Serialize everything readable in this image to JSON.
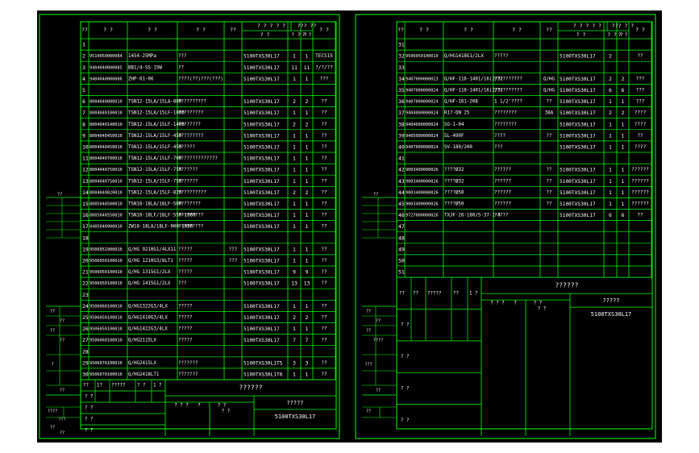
{
  "colors": {
    "background": "#000000",
    "line": "#00ff00",
    "text": "#ffffff",
    "page": "#ffffff"
  },
  "left_sheet": {
    "header": [
      "??",
      "? ?",
      "? ?",
      "? ?",
      "??",
      "? ? ? ? ?",
      "? ?",
      "??? ??",
      "? ?"
    ],
    "header_sub": [
      "? ?",
      "? ? ?",
      "? ?"
    ],
    "rows": [
      {
        "n": "1",
        "code": "",
        "name": "",
        "spec": "",
        "note": "",
        "part": "",
        "q1": "",
        "q2": "",
        "last": ""
      },
      {
        "n": "2",
        "code": "9510050000084",
        "name": "1454-25MPa",
        "spec": "???",
        "note": "",
        "part": "5100TXS30L17",
        "q1": "1",
        "q2": "1",
        "last": "TECS15"
      },
      {
        "n": "3",
        "code": "9404040000085",
        "name": "BB1/4-SS-15W",
        "spec": "??",
        "note": "",
        "part": "5100TXS30L17",
        "q1": "11",
        "q2": "11",
        "last": "?/?/??"
      },
      {
        "n": "4",
        "code": "9404040000086",
        "name": "ZHP-01-06",
        "spec": "????(??)???(???)",
        "note": "",
        "part": "5100TXS30L17",
        "q1": "1",
        "q2": "1",
        "last": "???"
      },
      {
        "n": "5",
        "code": "",
        "name": "",
        "spec": "",
        "note": "",
        "part": "",
        "q1": "",
        "q2": "",
        "last": ""
      },
      {
        "n": "6",
        "code": "8004040080010",
        "name": "TSN12-15LA/15LA-800",
        "spec": "??????????",
        "note": "",
        "part": "5100TXS30L17",
        "q1": "2",
        "q2": "2",
        "last": "??"
      },
      {
        "n": "7",
        "code": "8004040100010",
        "name": "TSN12-15LA/15LF-1000",
        "spec": "?????????",
        "note": "",
        "part": "5100TXS30L17",
        "q1": "1",
        "q2": "1",
        "last": "??"
      },
      {
        "n": "8",
        "code": "8004040140010",
        "name": "TSN12-15LA/15LF-1400",
        "spec": "????????",
        "note": "",
        "part": "5100TXS30L17",
        "q1": "2",
        "q2": "2",
        "last": "??"
      },
      {
        "n": "9",
        "code": "8004040450010",
        "name": "TSN12-15LA/15LF-450",
        "spec": "?????????",
        "note": "",
        "part": "5100TXS30L17",
        "q1": "1",
        "q2": "1",
        "last": "??"
      },
      {
        "n": "10",
        "code": "8004040450010",
        "name": "TSN12-15LA/15LF-450",
        "spec": "??????",
        "note": "",
        "part": "5100TXS30L17",
        "q1": "1",
        "q2": "1",
        "last": "??"
      },
      {
        "n": "11",
        "code": "8004040700010",
        "name": "TSN12-15LA/15LF-700",
        "spec": "??????????????",
        "note": "",
        "part": "5100TXS30L17",
        "q1": "1",
        "q2": "1",
        "last": "??"
      },
      {
        "n": "12",
        "code": "8004040750010",
        "name": "TSN12-15LA/15LF-750",
        "spec": "???????",
        "note": "",
        "part": "5100TXS30L17",
        "q1": "1",
        "q2": "1",
        "last": "??"
      },
      {
        "n": "13",
        "code": "8004040750010",
        "name": "TSN12-15LA/15LF-750",
        "spec": "???????",
        "note": "",
        "part": "5100TXS30L17",
        "q1": "1",
        "q2": "1",
        "last": "??"
      },
      {
        "n": "14",
        "code": "8004040820010",
        "name": "TSN12-15LA/15LF-820",
        "spec": "??????????",
        "note": "",
        "part": "5100TXS30L17",
        "q1": "2",
        "q2": "2",
        "last": "??"
      },
      {
        "n": "15",
        "code": "8005040500010",
        "name": "TSN16-18LA/18LF-500",
        "spec": "????????",
        "note": "",
        "part": "5100TXS30L17",
        "q1": "1",
        "q2": "1",
        "last": "??"
      },
      {
        "n": "16",
        "code": "8005040550010",
        "name": "TSN16-18LF/18LF-550-1000",
        "spec": "?????????",
        "note": "",
        "part": "5100TXS30L17",
        "q1": "1",
        "q2": "1",
        "last": "??"
      },
      {
        "n": "17",
        "code": "8405040900010",
        "name": "ZW18-18LA/18LF-900-1000",
        "spec": "?????????",
        "note": "",
        "part": "5100TXS30L17",
        "q1": "1",
        "q2": "1",
        "last": "??"
      },
      {
        "n": "18",
        "code": "",
        "name": "",
        "spec": "",
        "note": "",
        "part": "",
        "q1": "",
        "q2": "",
        "last": ""
      },
      {
        "n": "19",
        "code": "9506052900010",
        "name": "Q/HG 9210G1/4LX11",
        "spec": "?????",
        "note": "???",
        "part": "5100TXS30L17",
        "q1": "1",
        "q2": "1",
        "last": "??"
      },
      {
        "n": "20",
        "code": "9506050100010",
        "name": "Q/HG 1210G3/8LT1",
        "spec": "?????",
        "note": "???",
        "part": "5100TXS30L17",
        "q1": "1",
        "q2": "1",
        "last": "??"
      },
      {
        "n": "21",
        "code": "9506050100010",
        "name": "Q/HG 1315G1/2LX",
        "spec": "?????",
        "note": "",
        "part": "5100TXS30L17",
        "q1": "9",
        "q2": "9",
        "last": "??"
      },
      {
        "n": "22",
        "code": "9506050100010",
        "name": "Q/HG 1415G1/2LX",
        "spec": "???",
        "note": "",
        "part": "5100TXS30L17",
        "q1": "13",
        "q2": "13",
        "last": "??"
      },
      {
        "n": "23",
        "code": "",
        "name": "",
        "spec": "",
        "note": "",
        "part": "",
        "q1": "",
        "q2": "",
        "last": ""
      },
      {
        "n": "24",
        "code": "9506060100010",
        "name": "Q/HG1322G3/4LX",
        "spec": "?????",
        "note": "",
        "part": "5100TXS30L17",
        "q1": "1",
        "q2": "1",
        "last": "??"
      },
      {
        "n": "25",
        "code": "9506050100010",
        "name": "Q/HG1410G3/4LX",
        "spec": "?????",
        "note": "",
        "part": "5100TXS30L17",
        "q1": "2",
        "q2": "2",
        "last": "??"
      },
      {
        "n": "26",
        "code": "9506050100010",
        "name": "Q/HG1422G3/4LX",
        "spec": "?????",
        "note": "",
        "part": "5100TXS30L17",
        "q1": "1",
        "q2": "1",
        "last": "??"
      },
      {
        "n": "27",
        "code": "9506060100010",
        "name": "Q/HG2115LX",
        "spec": "?????",
        "note": "",
        "part": "5100TXS30L17",
        "q1": "7",
        "q2": "7",
        "last": "??"
      },
      {
        "n": "28",
        "code": "",
        "name": "",
        "spec": "",
        "note": "",
        "part": "",
        "q1": "",
        "q2": "",
        "last": ""
      },
      {
        "n": "29",
        "code": "9506070100010",
        "name": "Q/HG2415LX",
        "spec": "???????",
        "note": "",
        "part": "5100TXS30L1T5",
        "q1": "3",
        "q2": "3",
        "last": "??"
      },
      {
        "n": "30",
        "code": "9506070100010",
        "name": "Q/HG2418LT1",
        "spec": "???????",
        "note": "",
        "part": "5100TXS30L1T6",
        "q1": "1",
        "q2": "1",
        "last": "??"
      }
    ],
    "title_block": {
      "sign_row1": [
        "??",
        "1?",
        "?????",
        "? ?",
        "1 ?"
      ],
      "sign_row2": [
        "? ?"
      ],
      "sign_row3": [
        "? ?"
      ],
      "sign_row4": [
        "? ?"
      ],
      "sign_row5": [
        "? ?"
      ],
      "big_title": "??????",
      "sub_title": "?????",
      "mid_a": "? ? ?",
      "mid_b": "?",
      "mid_c": "? ?",
      "mid_d": "? ?",
      "drawing_no": "5100TXS30L17"
    },
    "side_labels": [
      "??",
      "??",
      "??",
      "??",
      "??",
      "?",
      "??",
      "????",
      "???",
      "??",
      "??"
    ]
  },
  "right_sheet": {
    "header": [
      "??",
      "? ?",
      "? ?",
      "? ?",
      "??",
      "? ? ? ? ?",
      "? ?",
      "??? ? ?",
      "? ?"
    ],
    "header_sub": [
      "? ?",
      "? ? ?",
      "? ?"
    ],
    "rows": [
      {
        "n": "31",
        "code": "",
        "name": "",
        "spec": "",
        "note": "",
        "part": "",
        "q1": "",
        "q2": "",
        "last": ""
      },
      {
        "n": "32",
        "code": "9506050100010",
        "name": "Q/HG1418G1/2LX",
        "spec": "?????",
        "note": "",
        "part": "5100TXS30L17",
        "q1": "2",
        "q2": "",
        "last": "??"
      },
      {
        "n": "33",
        "code": "",
        "name": "",
        "spec": "",
        "note": "",
        "part": "",
        "q1": "",
        "q2": "",
        "last": ""
      },
      {
        "n": "34",
        "code": "9407000000023",
        "name": "Q/HF-116-1401/16(2/3)",
        "spec": "??????????",
        "note": "Q/HG",
        "part": "5100TXS30L17",
        "q1": "2",
        "q2": "2",
        "last": "???"
      },
      {
        "n": "35",
        "code": "9407000000024",
        "name": "Q/HF-116-1401/16(2/3)",
        "spec": "??????????",
        "note": "Q/HG",
        "part": "5100TXS30L17",
        "q1": "6",
        "q2": "6",
        "last": "???"
      },
      {
        "n": "36",
        "code": "9407000000024",
        "name": "Q/HF-161-208",
        "spec": "1 1/2'????",
        "note": "??",
        "part": "5100TXS30L17",
        "q1": "1",
        "q2": "1",
        "last": "???"
      },
      {
        "n": "37",
        "code": "9404000000024",
        "name": "R17-DN 25",
        "spec": "????????",
        "note": "38A",
        "part": "5100TXS30L17",
        "q1": "2",
        "q2": "2",
        "last": "????"
      },
      {
        "n": "38",
        "code": "9404000000024",
        "name": "SG-1-04",
        "spec": "????????",
        "note": "",
        "part": "5100TXS30L17",
        "q1": "1",
        "q2": "1",
        "last": "????"
      },
      {
        "n": "39",
        "code": "9405000000024",
        "name": "SL-490F",
        "spec": "????",
        "note": "??",
        "part": "5100TXS30L17",
        "q1": "1",
        "q2": "1",
        "last": "??"
      },
      {
        "n": "40",
        "code": "9407000000024",
        "name": "SV-180/200",
        "spec": "???",
        "note": "",
        "part": "5100TXS30L17",
        "q1": "1",
        "q2": "1",
        "last": "????"
      },
      {
        "n": "41",
        "code": "",
        "name": "",
        "spec": "",
        "note": "",
        "part": "",
        "q1": "",
        "q2": "",
        "last": ""
      },
      {
        "n": "42",
        "code": "9003400000026",
        "name": "????Ø32",
        "spec": "??????",
        "note": "??",
        "part": "5100TXS30L17",
        "q1": "1",
        "q2": "1",
        "last": "??????"
      },
      {
        "n": "43",
        "code": "9003400000026",
        "name": "????Ø32",
        "spec": "??????",
        "note": "??",
        "part": "5100TXS30L17",
        "q1": "1",
        "q2": "1",
        "last": "??????"
      },
      {
        "n": "44",
        "code": "9003400000026",
        "name": "????Ø50",
        "spec": "??????",
        "note": "??",
        "part": "5100TXS30L17",
        "q1": "1",
        "q2": "1",
        "last": "??????"
      },
      {
        "n": "45",
        "code": "9003400000026",
        "name": "????Ø50",
        "spec": "??????",
        "note": "??",
        "part": "5100TXS30L17",
        "q1": "1",
        "q2": "1",
        "last": "??????"
      },
      {
        "n": "46",
        "code": "9727000000026",
        "name": "TXJF-26-180/5-37-1-4",
        "spec": "?????",
        "note": "",
        "part": "5100TXS30L17",
        "q1": "6",
        "q2": "6",
        "last": "??"
      },
      {
        "n": "47",
        "code": "",
        "name": "",
        "spec": "",
        "note": "",
        "part": "",
        "q1": "",
        "q2": "",
        "last": ""
      },
      {
        "n": "48",
        "code": "",
        "name": "",
        "spec": "",
        "note": "",
        "part": "",
        "q1": "",
        "q2": "",
        "last": ""
      },
      {
        "n": "49",
        "code": "",
        "name": "",
        "spec": "",
        "note": "",
        "part": "",
        "q1": "",
        "q2": "",
        "last": ""
      },
      {
        "n": "50",
        "code": "",
        "name": "",
        "spec": "",
        "note": "",
        "part": "",
        "q1": "",
        "q2": "",
        "last": ""
      },
      {
        "n": "51",
        "code": "",
        "name": "",
        "spec": "",
        "note": "",
        "part": "",
        "q1": "",
        "q2": "",
        "last": ""
      }
    ],
    "title_block": {
      "sign_row1": [
        "??",
        "??",
        "?????",
        "??",
        "1 ?"
      ],
      "sign_row2": [
        "? ?"
      ],
      "sign_row3": [
        "? ?"
      ],
      "sign_row4": [
        "? ?"
      ],
      "sign_row5": [
        "? ?"
      ],
      "big_title": "??????",
      "sub_title": "?????",
      "mid_a": "? ? ?",
      "mid_b": "?",
      "mid_c": "? ?",
      "mid_d": "? ?",
      "drawing_no": "5100TXS30L17"
    },
    "side_labels": [
      "??",
      "??",
      "??",
      "??",
      "????",
      "???",
      "??",
      "??"
    ]
  }
}
